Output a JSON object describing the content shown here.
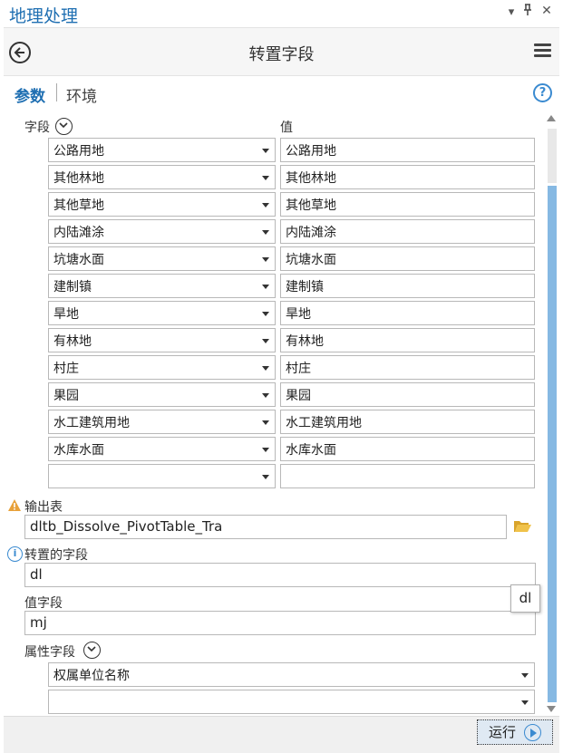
{
  "panel": {
    "title": "地理处理",
    "controls": [
      "▾",
      "ᚘ",
      "✕"
    ]
  },
  "tool": {
    "title": "转置字段"
  },
  "tabs": {
    "parameters": "参数",
    "environments": "环境"
  },
  "fields_section": {
    "label": "字段",
    "value_header": "值",
    "rows": [
      {
        "field": "公路用地",
        "value": "公路用地"
      },
      {
        "field": "其他林地",
        "value": "其他林地"
      },
      {
        "field": "其他草地",
        "value": "其他草地"
      },
      {
        "field": "内陆滩涂",
        "value": "内陆滩涂"
      },
      {
        "field": "坑塘水面",
        "value": "坑塘水面"
      },
      {
        "field": "建制镇",
        "value": "建制镇"
      },
      {
        "field": "旱地",
        "value": "旱地"
      },
      {
        "field": "有林地",
        "value": "有林地"
      },
      {
        "field": "村庄",
        "value": "村庄"
      },
      {
        "field": "果园",
        "value": "果园"
      },
      {
        "field": "水工建筑用地",
        "value": "水工建筑用地"
      },
      {
        "field": "水库水面",
        "value": "水库水面"
      },
      {
        "field": "",
        "value": ""
      }
    ]
  },
  "output_table": {
    "label": "输出表",
    "value": "dltb_Dissolve_PivotTable_Tra"
  },
  "transposed_field": {
    "label": "转置的字段",
    "value": "dl"
  },
  "value_field": {
    "label": "值字段",
    "value": "mj"
  },
  "attribute_fields": {
    "label": "属性字段",
    "rows": [
      "权属单位名称",
      ""
    ]
  },
  "tooltip": {
    "text": "dl"
  },
  "footer": {
    "run_label": "运行"
  },
  "colors": {
    "accent": "#1f6fb2",
    "scrollbar": "#86b9e3",
    "warning": "#e8a13a",
    "info": "#3a8ad0"
  }
}
